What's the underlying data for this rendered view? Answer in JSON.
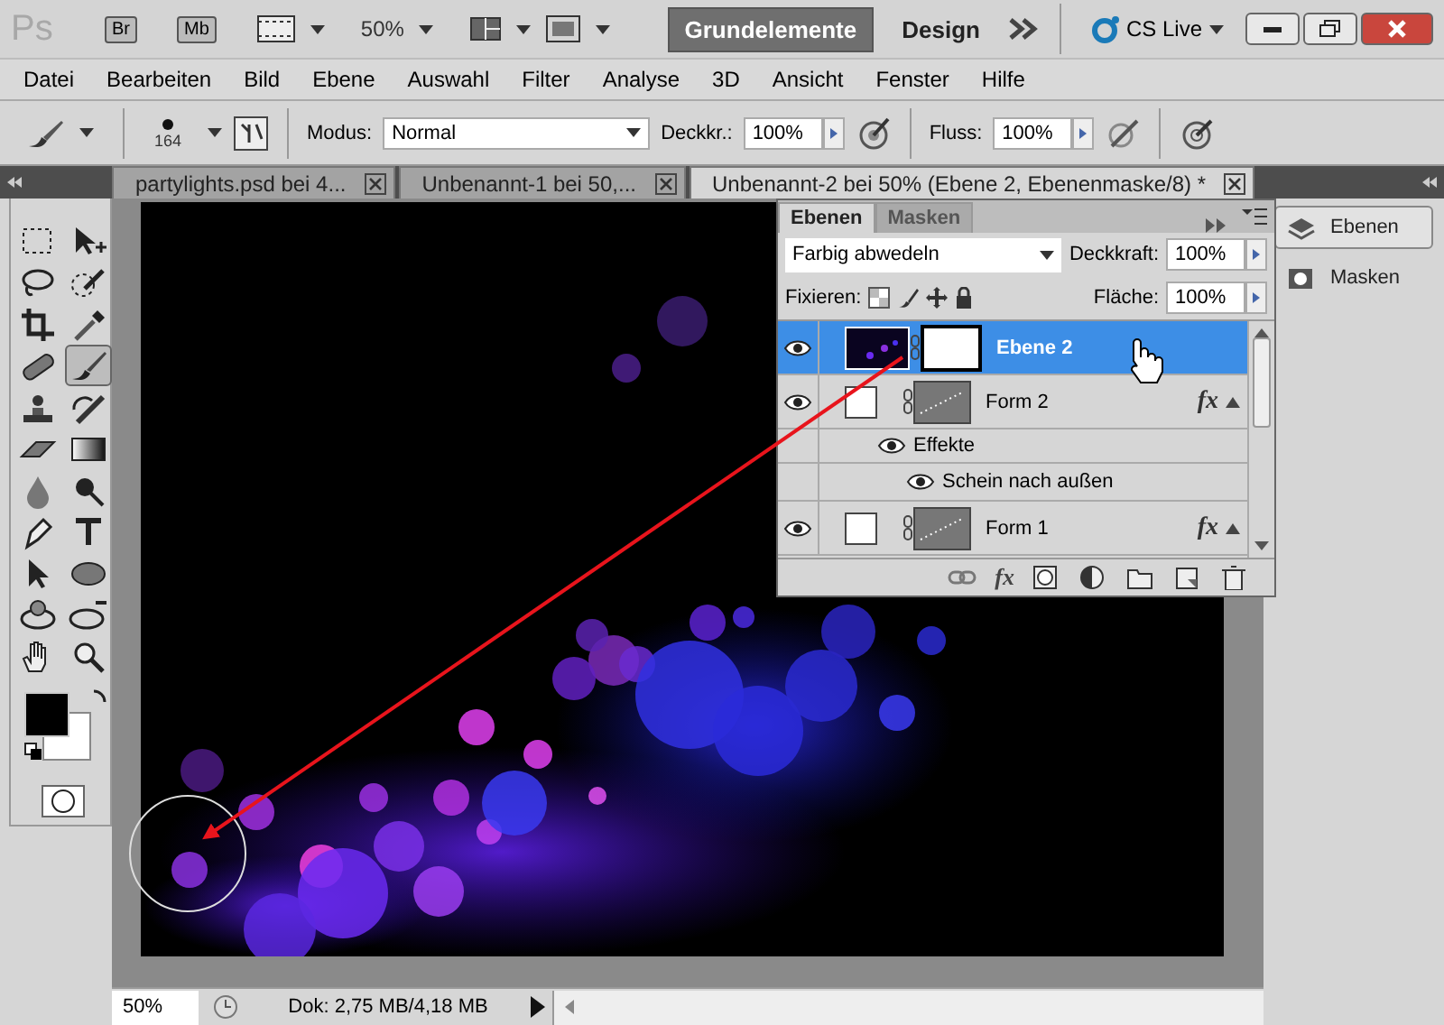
{
  "app_bar": {
    "logo": "Ps",
    "bridge_button": "Br",
    "mini_bridge_button": "Mb",
    "zoom": "50%",
    "cs_live": "CS Live"
  },
  "workspaces": [
    {
      "label": "Grundelemente",
      "selected": true
    },
    {
      "label": "Design",
      "selected": false
    }
  ],
  "menu": [
    "Datei",
    "Bearbeiten",
    "Bild",
    "Ebene",
    "Auswahl",
    "Filter",
    "Analyse",
    "3D",
    "Ansicht",
    "Fenster",
    "Hilfe"
  ],
  "options_bar": {
    "brush_size": "164",
    "mode_label": "Modus:",
    "mode": "Normal",
    "opacity_label": "Deckkr.:",
    "opacity": "100%",
    "flow_label": "Fluss:",
    "flow": "100%"
  },
  "documents": [
    {
      "title": "partylights.psd bei 4...",
      "selected": false
    },
    {
      "title": "Unbenannt-1 bei 50,...",
      "selected": false
    },
    {
      "title": "Unbenannt-2 bei 50% (Ebene 2, Ebenenmaske/8) *",
      "selected": true
    }
  ],
  "tools": [
    {
      "kind": "marquee",
      "selected": false
    },
    {
      "kind": "move",
      "selected": false
    },
    {
      "kind": "lasso",
      "selected": false
    },
    {
      "kind": "quick-select",
      "selected": false
    },
    {
      "kind": "crop",
      "selected": false
    },
    {
      "kind": "eyedropper",
      "selected": false
    },
    {
      "kind": "healing",
      "selected": false
    },
    {
      "kind": "brush",
      "selected": true
    },
    {
      "kind": "stamp",
      "selected": false
    },
    {
      "kind": "history-brush",
      "selected": false
    },
    {
      "kind": "eraser",
      "selected": false
    },
    {
      "kind": "gradient",
      "selected": false
    },
    {
      "kind": "blur",
      "selected": false
    },
    {
      "kind": "dodge",
      "selected": false
    },
    {
      "kind": "pen",
      "selected": false
    },
    {
      "kind": "type",
      "selected": false
    },
    {
      "kind": "path-select",
      "selected": false
    },
    {
      "kind": "ellipse",
      "selected": false
    },
    {
      "kind": "rotate-3d",
      "selected": false
    },
    {
      "kind": "orbit-3d",
      "selected": false
    },
    {
      "kind": "hand",
      "selected": false
    },
    {
      "kind": "zoom",
      "selected": false
    }
  ],
  "layers_panel": {
    "tabs": [
      {
        "label": "Ebenen",
        "selected": true
      },
      {
        "label": "Masken",
        "selected": false
      }
    ],
    "blend_mode": "Farbig abwedeln",
    "opacity_label": "Deckkraft:",
    "opacity": "100%",
    "lock_label": "Fixieren:",
    "fill_label": "Fläche:",
    "fill": "100%",
    "layers": [
      {
        "kind": "layer",
        "name": "Ebene 2",
        "visible": true,
        "selected": true,
        "vector_mask": false
      },
      {
        "kind": "layer",
        "name": "Form 2",
        "visible": true,
        "selected": false,
        "vector_mask": true,
        "fx": "fx",
        "expanded": true
      },
      {
        "kind": "effects",
        "label": "Effekte",
        "visible": true
      },
      {
        "kind": "effect",
        "label": "Schein nach außen",
        "visible": true
      },
      {
        "kind": "layer",
        "name": "Form 1",
        "visible": true,
        "selected": false,
        "vector_mask": true,
        "fx": "fx",
        "expanded": true
      }
    ],
    "footer": [
      {
        "kind": "link"
      },
      {
        "kind": "fx",
        "label": "fx"
      },
      {
        "kind": "mask"
      },
      {
        "kind": "adjustment"
      },
      {
        "kind": "folder"
      },
      {
        "kind": "new"
      },
      {
        "kind": "trash"
      }
    ]
  },
  "dock": [
    {
      "label": "Ebenen",
      "selected": true
    },
    {
      "label": "Masken",
      "selected": false
    }
  ],
  "status_bar": {
    "zoom": "50%",
    "doc_info": "Dok: 2,75 MB/4,18 MB"
  }
}
